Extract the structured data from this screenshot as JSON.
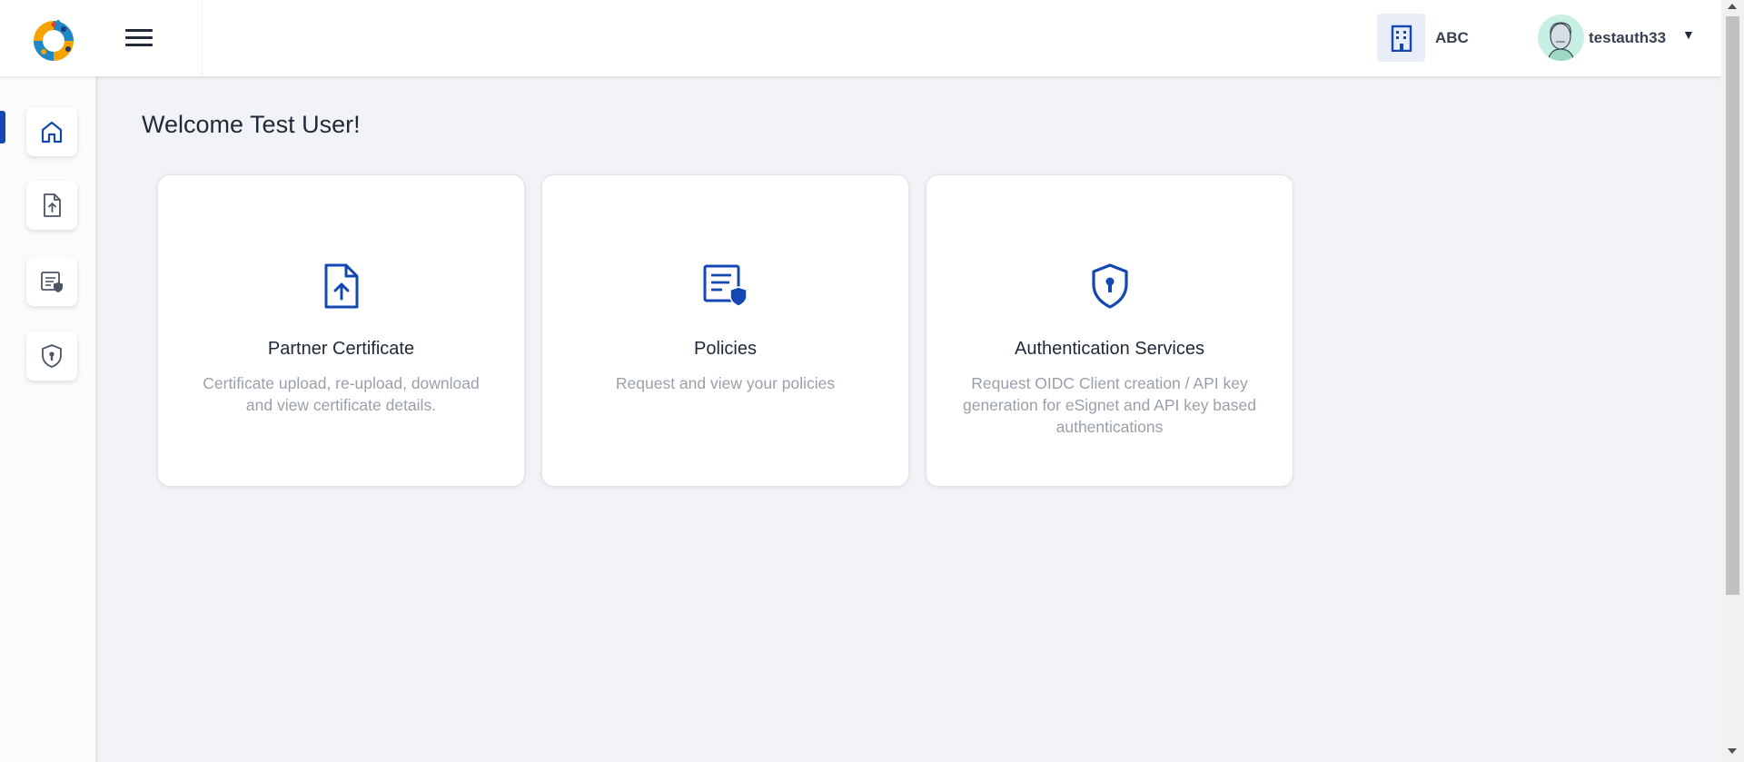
{
  "header": {
    "organization": {
      "name": "ABC",
      "icon": "building-icon"
    },
    "user": {
      "name": "testauth33",
      "avatar": "avatar"
    },
    "menu_icon": "hamburger-icon"
  },
  "sidebar": {
    "items": [
      {
        "icon": "home-icon",
        "active": true
      },
      {
        "icon": "file-upload-icon",
        "active": false
      },
      {
        "icon": "policy-document-icon",
        "active": false
      },
      {
        "icon": "shield-keyhole-icon",
        "active": false
      }
    ]
  },
  "main": {
    "welcome": "Welcome Test User!",
    "cards": [
      {
        "title": "Partner Certificate",
        "description": "Certificate upload, re-upload, download and view certificate details.",
        "icon": "file-upload-icon"
      },
      {
        "title": "Policies",
        "description": "Request and view your policies",
        "icon": "policy-document-icon"
      },
      {
        "title": "Authentication Services",
        "description": "Request OIDC Client creation / API key generation for eSignet and API key based authentications",
        "icon": "shield-keyhole-icon"
      }
    ]
  },
  "colors": {
    "accent": "#1447b2",
    "background": "#f2f3f6",
    "muted_text": "#9aa0ab"
  }
}
